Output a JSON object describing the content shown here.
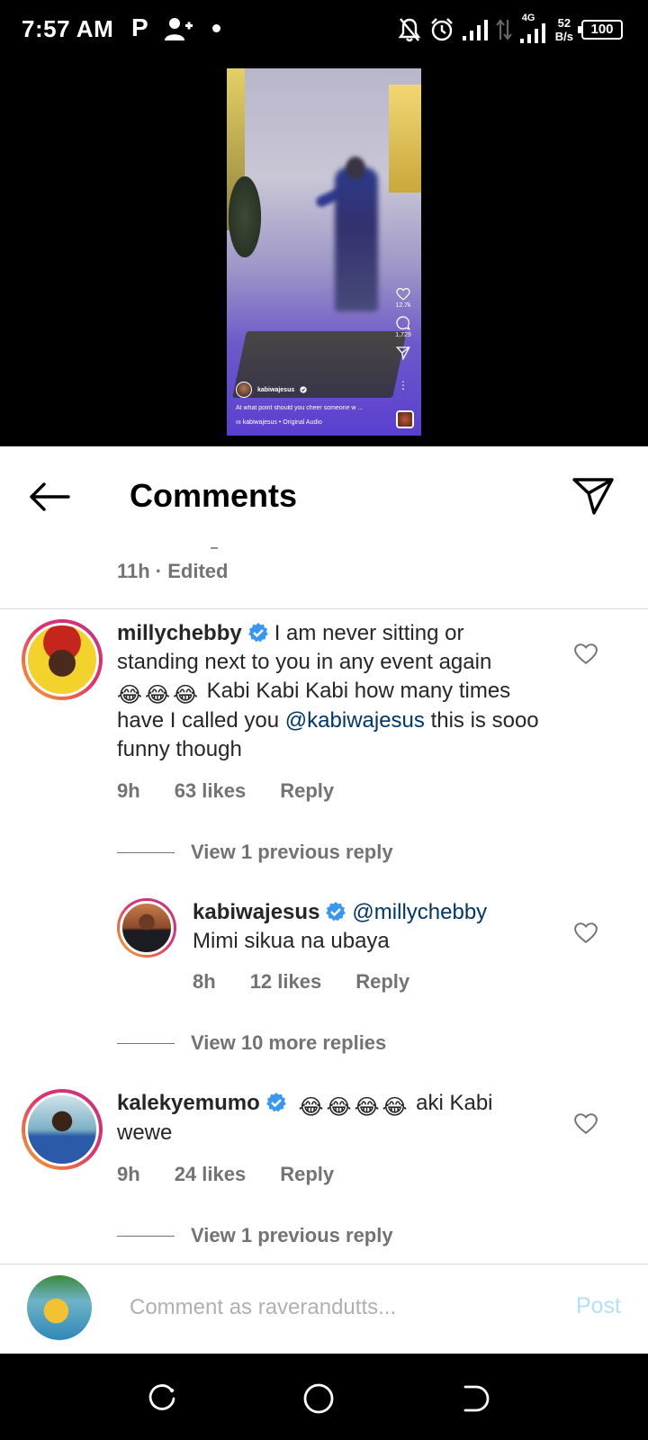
{
  "status_bar": {
    "time": "7:57 AM",
    "p_indicator": "P",
    "net_speed_value": "52",
    "net_speed_unit": "B/s",
    "network_type": "4G",
    "battery": "100"
  },
  "reel": {
    "username": "kabiwajesus",
    "likes": "12.7k",
    "comments": "1,729",
    "caption": "At what point should you cheer someone w ...",
    "audio": "kabiwajesus • Original Audio"
  },
  "header": {
    "title": "Comments"
  },
  "previous_comment": {
    "meta": "11h · Edited"
  },
  "comments": [
    {
      "username": "millychebby",
      "text_part1": "I  am never sitting or standing next to you in any event again",
      "emojis": [
        "😂",
        "😂",
        "😂"
      ],
      "text_part2": "Kabi Kabi Kabi how many times have I called you",
      "mention": "@kabiwajesus",
      "text_part3": "this is sooo funny though",
      "time": "9h",
      "likes": "63 likes",
      "reply": "Reply",
      "view_replies": "View 1 previous reply"
    },
    {
      "username": "kabiwajesus",
      "mention": "@millychebby",
      "text": "Mimi sikua na ubaya",
      "time": "8h",
      "likes": "12 likes",
      "reply": "Reply",
      "view_replies": "View 10 more replies"
    },
    {
      "username": "kalekyemumo",
      "emojis": [
        "😂",
        "😂",
        "😂",
        "😂"
      ],
      "text": "aki Kabi wewe",
      "time": "9h",
      "likes": "24 likes",
      "reply": "Reply",
      "view_replies": "View 1 previous reply"
    }
  ],
  "composer": {
    "placeholder": "Comment as raverandutts...",
    "post_label": "Post"
  },
  "colors": {
    "verified": "#3897f0",
    "mention": "#00376b",
    "post_disabled": "#b2dffc",
    "secondary_text": "#737373"
  }
}
